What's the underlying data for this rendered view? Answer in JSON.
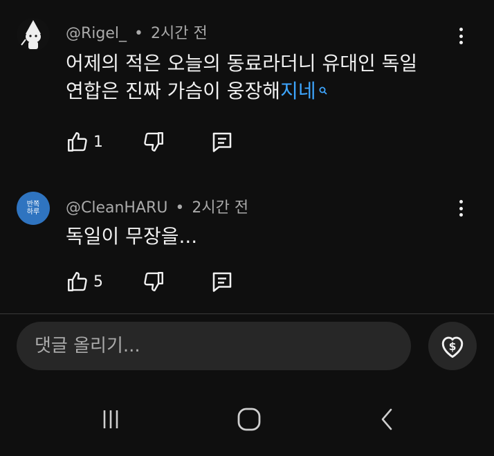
{
  "comments": [
    {
      "author": "@Rigel_",
      "time": "2시간 전",
      "text_line1": "어제의 적은 오늘의 동료라더니 유대인 독일",
      "text_line2": "연합은 진짜 가슴이 웅장해",
      "hashtag": "지네",
      "hashtag_icon": "search-icon",
      "likes": "1",
      "avatar_icon": "cartoon-avatar-icon"
    },
    {
      "author": "@CleanHARU",
      "time": "2시간 전",
      "text": "독일이 무장을...",
      "likes": "5",
      "avatar_text_line1": "반쪽",
      "avatar_text_line2": "하루"
    }
  ],
  "separator": "•",
  "composer": {
    "placeholder": "댓글 올리기..."
  },
  "icons": {
    "like": "thumbs-up-icon",
    "dislike": "thumbs-down-icon",
    "reply": "reply-comment-icon",
    "more": "more-vertical-icon",
    "thanks": "super-thanks-heart-dollar-icon",
    "nav_recent": "recent-apps-icon",
    "nav_home": "home-icon",
    "nav_back": "back-icon"
  },
  "colors": {
    "background": "#0f0f0f",
    "link": "#3ea6ff",
    "meta": "#aaaaaa",
    "avatar2": "#2f74c0"
  }
}
